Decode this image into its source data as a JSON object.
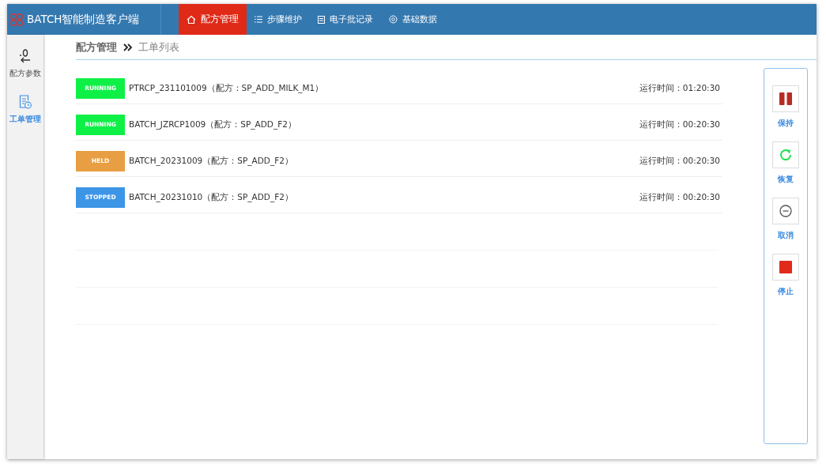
{
  "header": {
    "title": "BATCH智能制造客户端"
  },
  "nav": [
    {
      "label": "配方管理",
      "kind": "home",
      "selected": true
    },
    {
      "label": "步骤维护",
      "kind": "steps",
      "selected": false
    },
    {
      "label": "电子批记录",
      "kind": "records",
      "selected": false
    },
    {
      "label": "基础数据",
      "kind": "basics",
      "selected": false
    }
  ],
  "sidebar": {
    "items": [
      {
        "label": "配方参数",
        "kind": "params",
        "selected": false
      },
      {
        "label": "工单管理",
        "kind": "orders",
        "selected": true
      }
    ]
  },
  "breadcrumb": {
    "parent": "配方管理",
    "current": "工单列表"
  },
  "orders": [
    {
      "status": "RUNNING",
      "color": "#0ff046",
      "name": "PTRCP_231101009（配方：SP_ADD_MILK_M1）",
      "runtime": "运行时间：01:20:30"
    },
    {
      "status": "RUNNING",
      "color": "#0ff046",
      "name": "BATCH_JZRCP1009（配方：SP_ADD_F2）",
      "runtime": "运行时间：00:20:30"
    },
    {
      "status": "HELD",
      "color": "#e89e42",
      "name": "BATCH_20231009（配方：SP_ADD_F2）",
      "runtime": "运行时间：00:20:30"
    },
    {
      "status": "STOPPED",
      "color": "#3d95e6",
      "name": "BATCH_20231010（配方：SP_ADD_F2）",
      "runtime": "运行时间：00:20:30"
    }
  ],
  "actions": [
    {
      "kind": "hold",
      "label": "保持"
    },
    {
      "kind": "resume",
      "label": "恢复"
    },
    {
      "kind": "cancel",
      "label": "取消"
    },
    {
      "kind": "stop",
      "label": "停止"
    }
  ]
}
